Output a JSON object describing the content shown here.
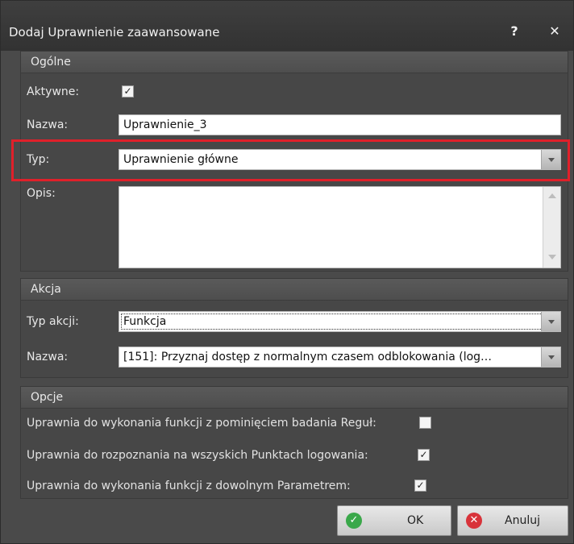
{
  "window": {
    "title": "Dodaj Uprawnienie zaawansowane",
    "help_glyph": "?",
    "close_glyph": "✕"
  },
  "general": {
    "header": "Ogólne",
    "active_label": "Aktywne:",
    "active_checked": true,
    "name_label": "Nazwa:",
    "name_value": "Uprawnienie_3",
    "type_label": "Typ:",
    "type_value": "Uprawnienie główne",
    "description_label": "Opis:",
    "description_value": ""
  },
  "action": {
    "header": "Akcja",
    "action_type_label": "Typ akcji:",
    "action_type_value": "Funkcja",
    "name_label": "Nazwa:",
    "name_value": "[151]: Przyznaj dostęp z normalnym czasem odblokowania (log…"
  },
  "options": {
    "header": "Opcje",
    "items": [
      {
        "label": "Uprawnia do wykonania funkcji z pominięciem badania Reguł:",
        "checked": false
      },
      {
        "label": "Uprawnia do rozpoznania na wszyskich Punktach logowania:",
        "checked": true
      },
      {
        "label": "Uprawnia do wykonania funkcji z dowolnym Parametrem:",
        "checked": true
      }
    ]
  },
  "buttons": {
    "ok_label": "OK",
    "cancel_label": "Anuluj"
  },
  "colors": {
    "highlight": "#e0202a",
    "ok_icon": "#3aa84a",
    "cancel_icon": "#d8333a"
  },
  "icons": {
    "check": "✓",
    "ok": "check-circle-icon",
    "cancel": "x-circle-icon"
  }
}
